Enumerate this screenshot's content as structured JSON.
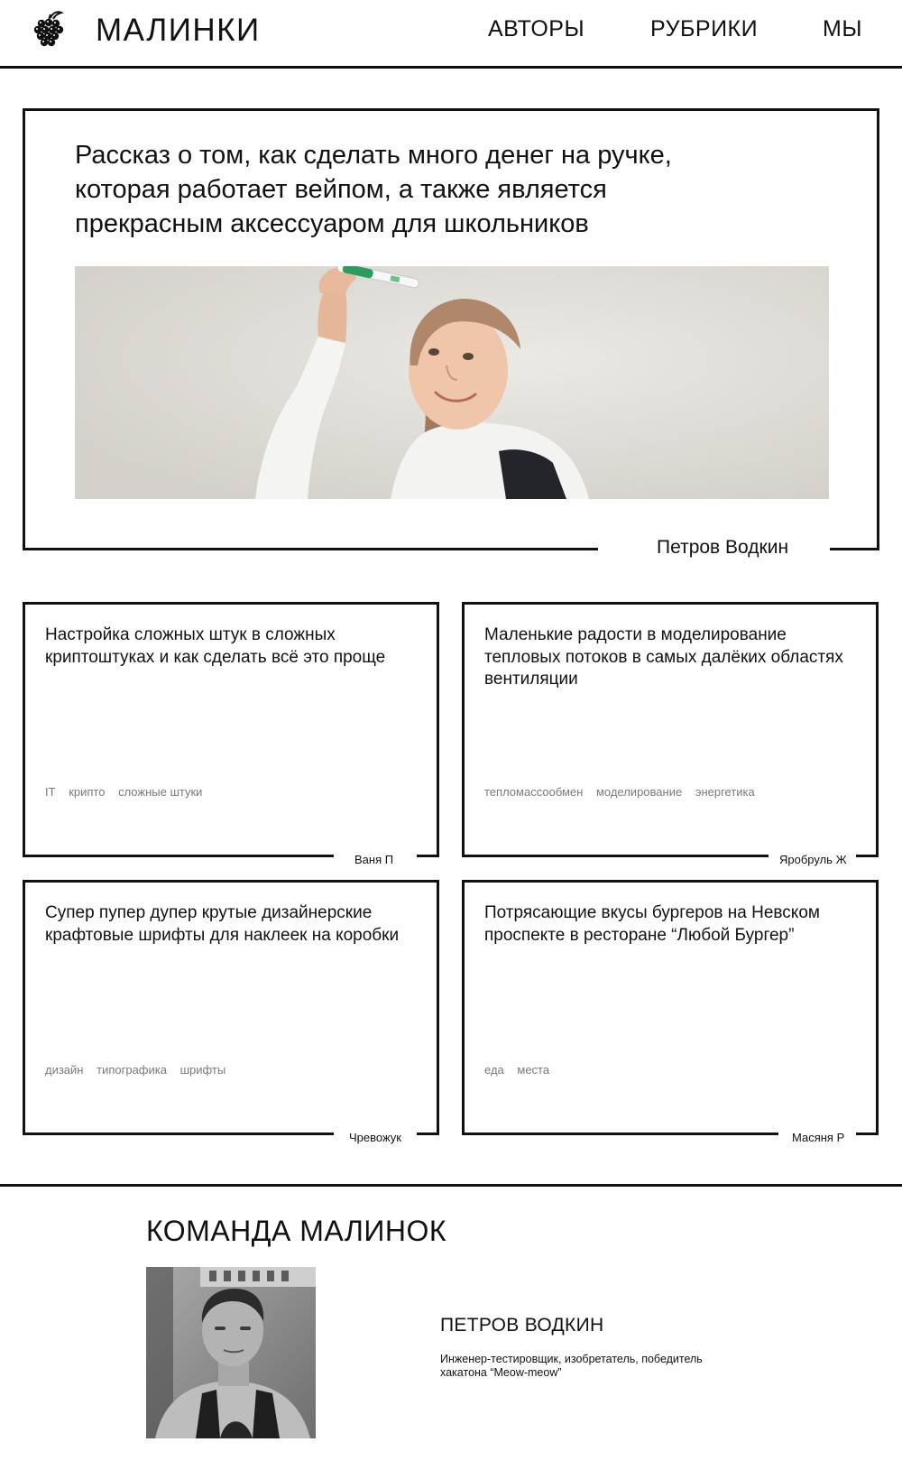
{
  "header": {
    "brand": "МАЛИНКИ",
    "nav": {
      "authors": "АВТОРЫ",
      "rubrics": "РУБРИКИ",
      "us": "МЫ"
    }
  },
  "featured": {
    "title": "Рассказ о том, как сделать много денег на ручке, которая работает вейпом, а также является прекрасным аксессуаром для школьников",
    "author": "Петров Водкин"
  },
  "articles": [
    {
      "title": "Настройка сложных штук в сложных криптоштуках и как сделать всё это проще",
      "tags": [
        "IT",
        "крипто",
        "сложные штуки"
      ],
      "author": "Ваня П"
    },
    {
      "title": "Маленькие радости в моделирование тепловых потоков в самых далёких областях вентиляции",
      "tags": [
        "тепломассообмен",
        "моделирование",
        "энергетика"
      ],
      "author": "Яробруль Ж"
    },
    {
      "title": "Супер пупер дупер крутые дизайнерские крафтовые шрифты для наклеек на коробки",
      "tags": [
        "дизайн",
        "типографика",
        "шрифты"
      ],
      "author": "Чревожук"
    },
    {
      "title": "Потрясающие вкусы бургеров на Невском проспекте в ресторане “Любой Бургер”",
      "tags": [
        "еда",
        "места"
      ],
      "author": "Масяня Р"
    }
  ],
  "team": {
    "title": "КОМАНДА МАЛИНОК",
    "member": {
      "name": "ПЕТРОВ ВОДКИН",
      "description": "Инженер-тестировщик, изобретатель, победитель хакатона “Meow-meow”"
    }
  }
}
